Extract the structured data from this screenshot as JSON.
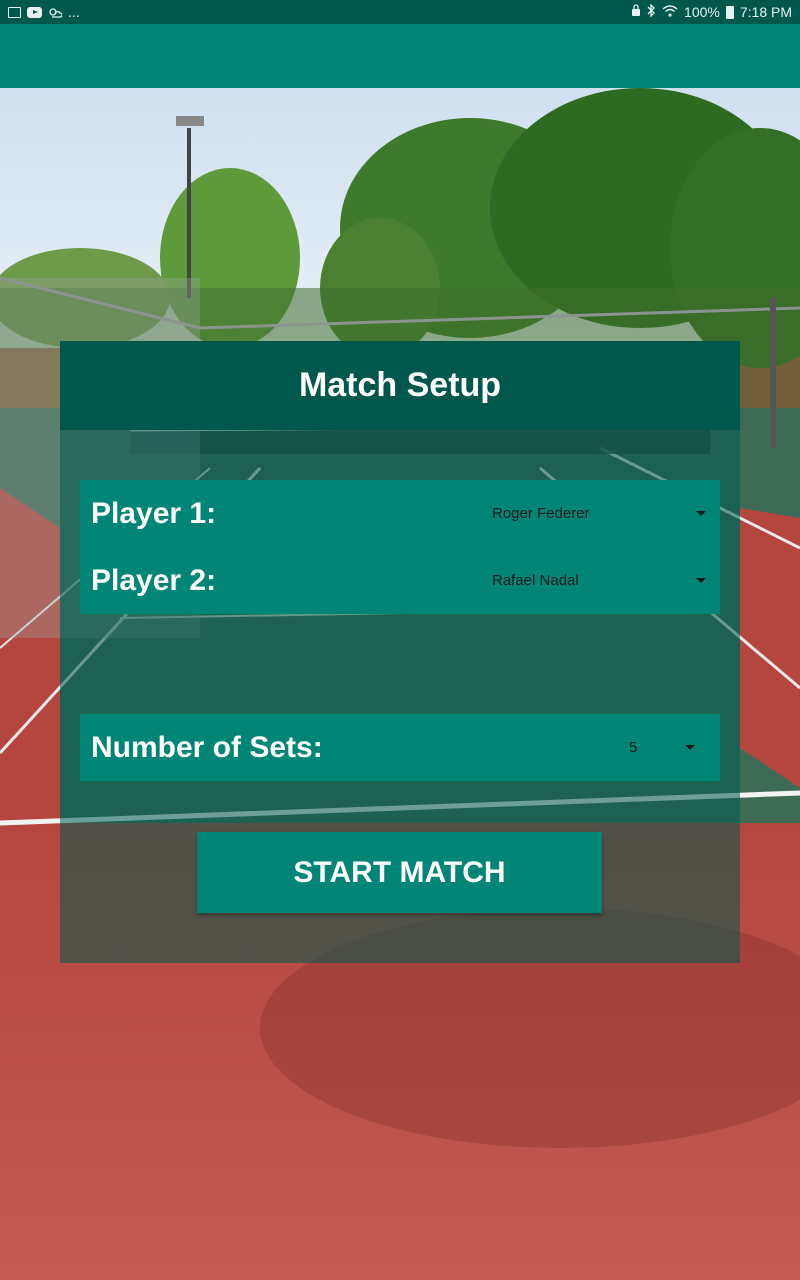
{
  "status_bar": {
    "left_icons": [
      "image-icon",
      "youtube-icon",
      "weather-icon"
    ],
    "more": "...",
    "battery": "100%",
    "time": "7:18 PM"
  },
  "card": {
    "title": "Match Setup",
    "player1": {
      "label": "Player 1:",
      "value": "Roger Federer"
    },
    "player2": {
      "label": "Player 2:",
      "value": "Rafael Nadal"
    },
    "sets": {
      "label": "Number of Sets:",
      "value": "5"
    },
    "start_button": "START MATCH"
  },
  "colors": {
    "primary": "#008577",
    "primary_dark": "#00574b",
    "court_red": "#b4504a",
    "court_green": "#3e6b56"
  }
}
